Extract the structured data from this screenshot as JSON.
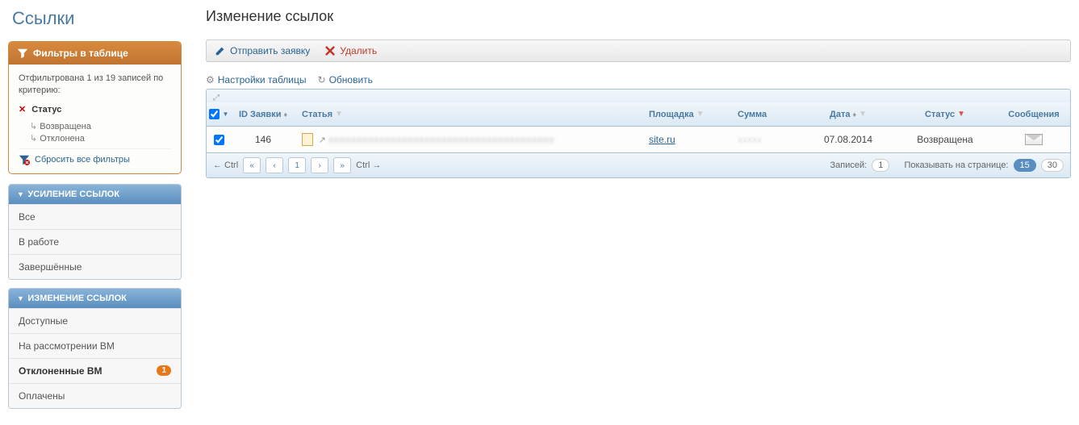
{
  "sidebar": {
    "title": "Ссылки",
    "filter": {
      "header": "Фильтры в таблице",
      "info": "Отфильтрована 1 из 19 записей по критерию:",
      "status_label": "Статус",
      "values": [
        "Возвращена",
        "Отклонена"
      ],
      "reset": "Сбросить все фильтры"
    },
    "nav1": {
      "header": "УСИЛЕНИЕ ССЫЛОК",
      "items": [
        "Все",
        "В работе",
        "Завершённые"
      ]
    },
    "nav2": {
      "header": "ИЗМЕНЕНИЕ ССЫЛОК",
      "items": [
        {
          "label": "Доступные",
          "badge": null
        },
        {
          "label": "На рассмотрении ВМ",
          "badge": null
        },
        {
          "label": "Отклоненные ВМ",
          "badge": "1",
          "active": true
        },
        {
          "label": "Оплачены",
          "badge": null
        }
      ]
    }
  },
  "main": {
    "title": "Изменение ссылок",
    "toolbar": {
      "send": "Отправить заявку",
      "delete": "Удалить"
    },
    "table_ctrl": {
      "settings": "Настройки таблицы",
      "refresh": "Обновить"
    },
    "columns": {
      "id": "ID Заявки",
      "article": "Статья",
      "site": "Площадка",
      "sum": "Сумма",
      "date": "Дата",
      "status": "Статус",
      "msg": "Сообщения"
    },
    "rows": [
      {
        "checked": true,
        "id": "146",
        "article_blur": "xxxxxxxxxxxxxxxxxxxxxxxxxxxxxxxxxxxxxxxx",
        "site": "site.ru",
        "sum_blur": "xxxxx",
        "date": "07.08.2014",
        "status": "Возвращена"
      }
    ],
    "pager": {
      "ctrl_hint_left": "← Ctrl",
      "ctrl_hint_right": "Ctrl →",
      "page": "1",
      "records_label": "Записей:",
      "records": "1",
      "per_page_label": "Показывать на странице:",
      "sizes": [
        "15",
        "30"
      ],
      "active_size": "15"
    }
  }
}
